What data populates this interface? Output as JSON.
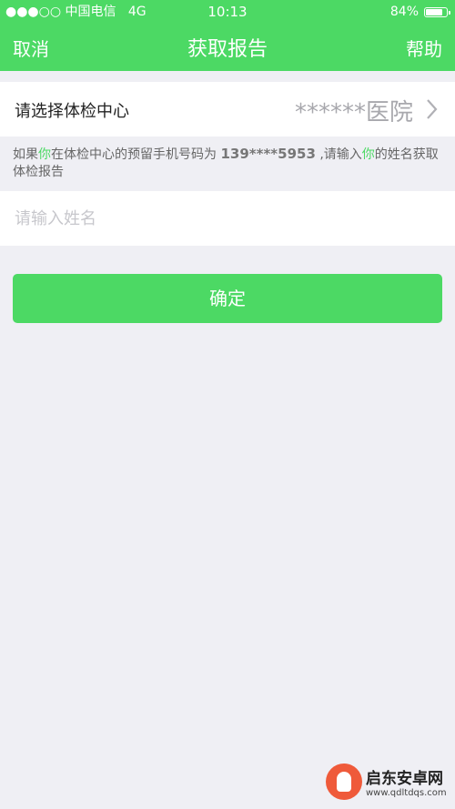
{
  "status_bar": {
    "carrier": "●●●○○ 中国电信",
    "network": "4G",
    "time": "10:13",
    "battery": "84%",
    "battery_level": 0.84
  },
  "nav": {
    "cancel": "取消",
    "title": "获取报告",
    "help": "帮助"
  },
  "center_row": {
    "label": "请选择体检中心",
    "value": "******医院"
  },
  "hint": {
    "part1": "如果",
    "you1": "你",
    "part2": "在体检中心的预留手机号码为 ",
    "phone": "139****5953",
    "part3": " ,请输入",
    "you2": "你",
    "part4": "的姓名获取体检报告"
  },
  "name_input": {
    "placeholder": "请输入姓名",
    "value": ""
  },
  "confirm_button": "确定",
  "watermark": {
    "cn": "启东安卓网",
    "url": "www.qdltdqs.com"
  },
  "colors": {
    "accent": "#4cd964",
    "background": "#efeff4"
  }
}
